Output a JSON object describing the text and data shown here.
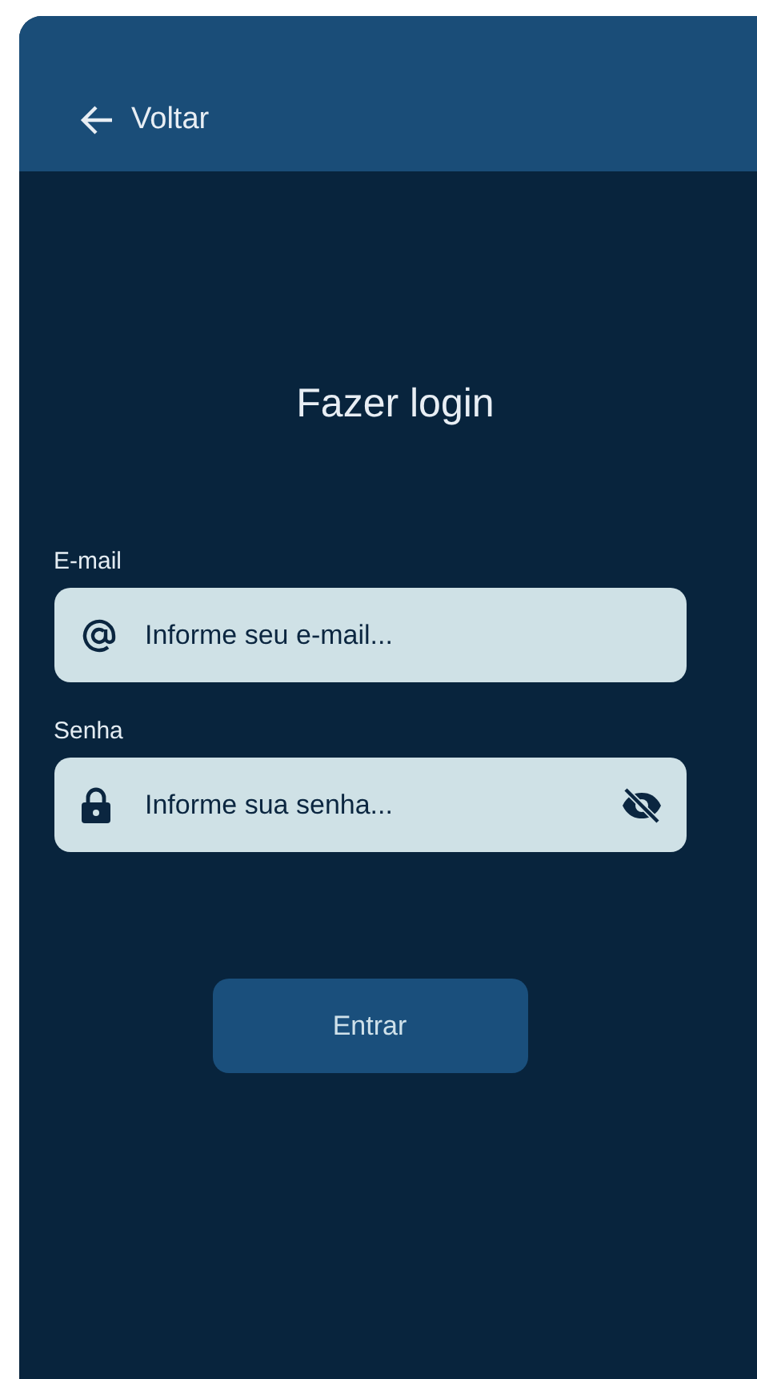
{
  "header": {
    "back_label": "Voltar"
  },
  "title": "Fazer login",
  "fields": [
    {
      "kind": "email",
      "label": "E-mail",
      "placeholder": "Informe seu e-mail..."
    },
    {
      "kind": "password",
      "label": "Senha",
      "placeholder": "Informe sua senha..."
    }
  ],
  "submit": "Entrar"
}
